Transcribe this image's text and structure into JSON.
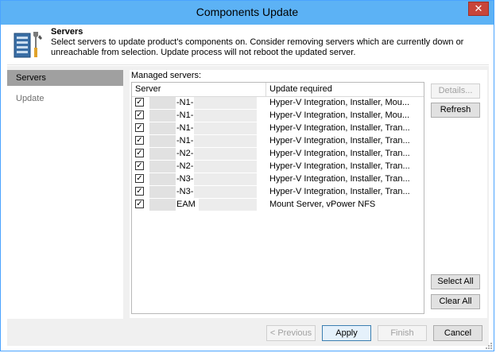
{
  "window": {
    "title": "Components Update",
    "close_glyph": "✕"
  },
  "header": {
    "title": "Servers",
    "description": "Select servers to update product's components on. Consider removing servers which are currently down or unreachable from selection. Update process will not reboot the updated server.",
    "icon": "tools-server-icon"
  },
  "sidebar": {
    "items": [
      {
        "label": "Servers",
        "active": true
      },
      {
        "label": "Update",
        "active": false
      }
    ]
  },
  "content": {
    "managed_label": "Managed servers:",
    "columns": {
      "server": "Server",
      "update": "Update required"
    },
    "rows": [
      {
        "checked": true,
        "server": "-N1-",
        "update": "Hyper-V Integration, Installer, Mou..."
      },
      {
        "checked": true,
        "server": "-N1-",
        "update": "Hyper-V Integration, Installer, Mou..."
      },
      {
        "checked": true,
        "server": "-N1-",
        "update": "Hyper-V Integration, Installer, Tran..."
      },
      {
        "checked": true,
        "server": "-N1-",
        "update": "Hyper-V Integration, Installer, Tran..."
      },
      {
        "checked": true,
        "server": "-N2-",
        "update": "Hyper-V Integration, Installer, Tran..."
      },
      {
        "checked": true,
        "server": "-N2-",
        "update": "Hyper-V Integration, Installer, Tran..."
      },
      {
        "checked": true,
        "server": "-N3-",
        "update": "Hyper-V Integration, Installer, Tran..."
      },
      {
        "checked": true,
        "server": "-N3-",
        "update": "Hyper-V Integration, Installer, Tran..."
      },
      {
        "checked": true,
        "server": "EAM",
        "update": "Mount Server, vPower NFS"
      }
    ],
    "buttons": {
      "details": "Details...",
      "refresh": "Refresh",
      "select_all": "Select All",
      "clear_all": "Clear All"
    }
  },
  "footer": {
    "previous": "< Previous",
    "apply": "Apply",
    "finish": "Finish",
    "cancel": "Cancel"
  },
  "colors": {
    "titlebar": "#5cb2f5",
    "close": "#c8453a",
    "sidebar_active": "#a0a0a0"
  }
}
